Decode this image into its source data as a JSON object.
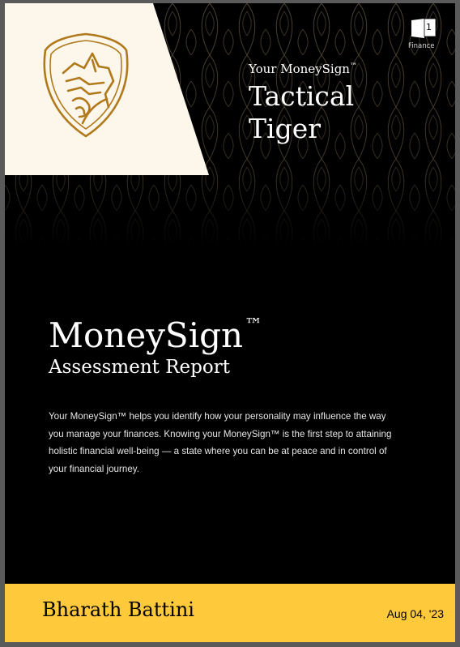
{
  "brand": {
    "number": "1",
    "name": "Finance"
  },
  "header": {
    "moneysign_label": "Your MoneySign",
    "trademark": "™",
    "persona_line1": "Tactical",
    "persona_line2": "Tiger"
  },
  "main": {
    "title": "MoneySign",
    "title_trademark": "™",
    "subtitle": "Assessment Report",
    "description": "Your MoneySign™ helps you identify how your personality may influence the way you manage your finances. Knowing your MoneySign™ is the first step to attaining holistic financial well-being — a state where you can be at peace and in control of your financial journey."
  },
  "footer": {
    "name": "Bharath Battini",
    "date": "Aug 04, '23"
  },
  "colors": {
    "background": "#000000",
    "logo_panel": "#fdf6ea",
    "gold": "#b07a1c",
    "footer": "#ffc93c"
  },
  "icons": [
    "tiger-shield-icon",
    "one-finance-logo-icon"
  ]
}
